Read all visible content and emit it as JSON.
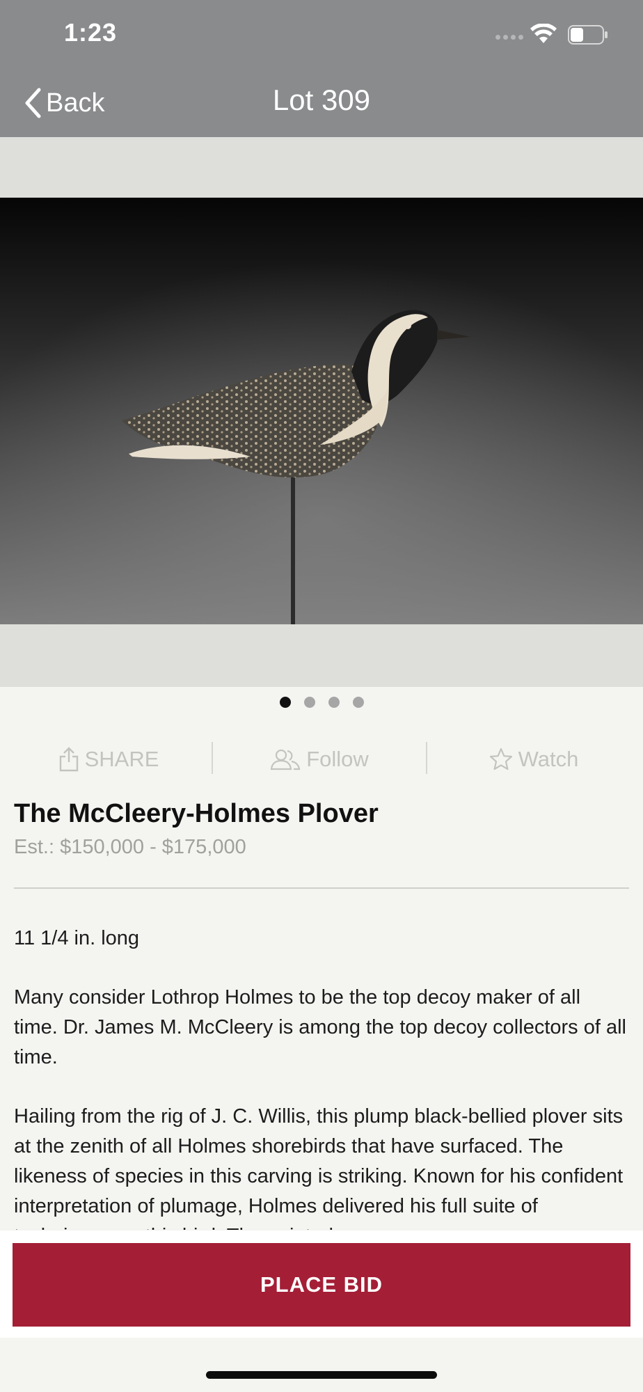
{
  "status_bar": {
    "time": "1:23",
    "signal_icon": "signal-dots-icon",
    "wifi_icon": "wifi-icon",
    "battery_icon": "battery-icon",
    "battery_level": 0.4
  },
  "nav": {
    "back_label": "Back",
    "back_icon": "chevron-left-icon",
    "title": "Lot 309"
  },
  "carousel": {
    "image_count": 4,
    "active_index": 0,
    "image_alt": "Black-bellied plover decoy on a stand"
  },
  "actions": [
    {
      "label": "SHARE",
      "icon": "share-icon"
    },
    {
      "label": "Follow",
      "icon": "users-icon"
    },
    {
      "label": "Watch",
      "icon": "star-icon"
    }
  ],
  "lot": {
    "title": "The McCleery-Holmes Plover",
    "estimate": "Est.: $150,000 - $175,000"
  },
  "description": {
    "dimensions": "11 1/4 in. long",
    "paragraph_1": "Many consider Lothrop Holmes to be the top decoy maker of all time. Dr. James M. McCleery is among the top decoy collectors of all time.",
    "paragraph_2": "Hailing from the rig of J. C. Willis, this plump black-bellied plover sits at the zenith of all Holmes shorebirds that have surfaced. The likeness of species in this carving is striking. Known for his confident interpretation of plumage, Holmes delivered his full suite of techniques on this bird. The painted"
  },
  "bid_button": {
    "label": "PLACE BID",
    "color": "#a41e36"
  },
  "colors": {
    "header": "#8a8b8d",
    "background": "#f4f4f1",
    "muted_text": "#a0a09d"
  }
}
